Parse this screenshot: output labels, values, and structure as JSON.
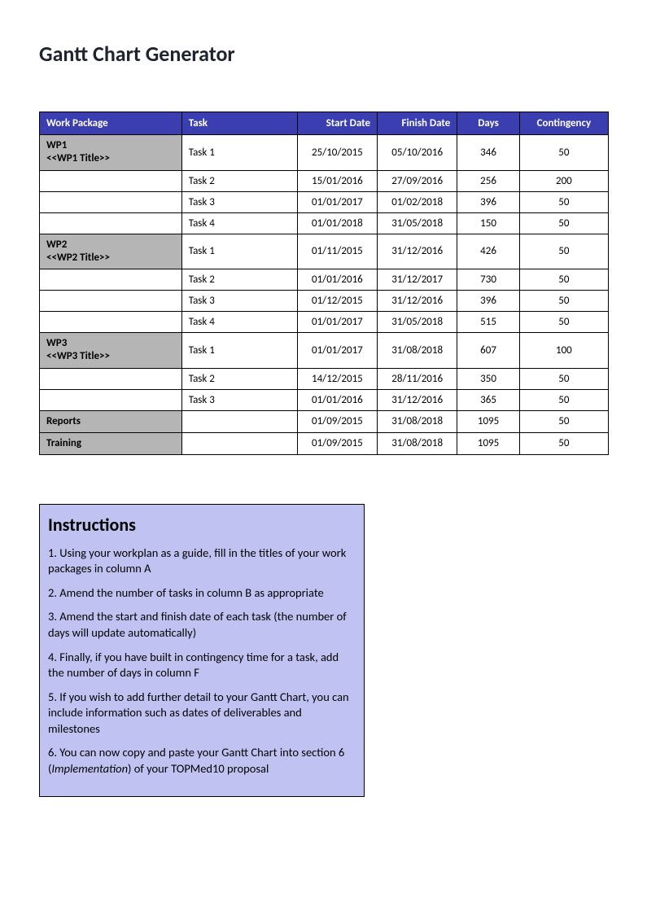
{
  "page": {
    "title": "Gantt Chart Generator"
  },
  "table": {
    "headers": {
      "wp": "Work Package",
      "task": "Task",
      "start": "Start Date",
      "finish": "Finish Date",
      "days": "Days",
      "cont": "Contingency"
    },
    "rows": [
      {
        "wp": "WP1\n<<WP1 Title>>",
        "task": "Task 1",
        "start": "25/10/2015",
        "finish": "05/10/2016",
        "days": "346",
        "cont": "50"
      },
      {
        "wp": "",
        "task": "Task 2",
        "start": "15/01/2016",
        "finish": "27/09/2016",
        "days": "256",
        "cont": "200"
      },
      {
        "wp": "",
        "task": "Task 3",
        "start": "01/01/2017",
        "finish": "01/02/2018",
        "days": "396",
        "cont": "50"
      },
      {
        "wp": "",
        "task": "Task 4",
        "start": "01/01/2018",
        "finish": "31/05/2018",
        "days": "150",
        "cont": "50"
      },
      {
        "wp": "WP2\n<<WP2 Title>>",
        "task": "Task 1",
        "start": "01/11/2015",
        "finish": "31/12/2016",
        "days": "426",
        "cont": "50"
      },
      {
        "wp": "",
        "task": "Task 2",
        "start": "01/01/2016",
        "finish": "31/12/2017",
        "days": "730",
        "cont": "50"
      },
      {
        "wp": "",
        "task": "Task 3",
        "start": "01/12/2015",
        "finish": "31/12/2016",
        "days": "396",
        "cont": "50"
      },
      {
        "wp": "",
        "task": "Task 4",
        "start": "01/01/2017",
        "finish": "31/05/2018",
        "days": "515",
        "cont": "50"
      },
      {
        "wp": "WP3\n<<WP3 Title>>",
        "task": "Task 1",
        "start": "01/01/2017",
        "finish": "31/08/2018",
        "days": "607",
        "cont": "100"
      },
      {
        "wp": "",
        "task": "Task 2",
        "start": "14/12/2015",
        "finish": "28/11/2016",
        "days": "350",
        "cont": "50"
      },
      {
        "wp": "",
        "task": "Task 3",
        "start": "01/01/2016",
        "finish": "31/12/2016",
        "days": "365",
        "cont": "50"
      },
      {
        "wp": "Reports",
        "task": "",
        "start": "01/09/2015",
        "finish": "31/08/2018",
        "days": "1095",
        "cont": "50"
      },
      {
        "wp": "Training",
        "task": "",
        "start": "01/09/2015",
        "finish": "31/08/2018",
        "days": "1095",
        "cont": "50"
      }
    ]
  },
  "instructions": {
    "title": "Instructions",
    "items": [
      "1. Using your workplan as a guide, fill in the titles of your work packages in column A",
      "2. Amend the number of tasks in column B as appropriate",
      "3. Amend the start and finish date of each task (the number of days will update automatically)",
      "4. Finally, if you have built in contingency time for a task, add the number of days in column F",
      "5. If you wish to add further detail to your Gantt Chart, you can include information such as dates of deliverables and milestones",
      "6. You can now copy and paste your Gantt Chart into section 6 (Implementation) of your TOPMed10 proposal"
    ]
  }
}
